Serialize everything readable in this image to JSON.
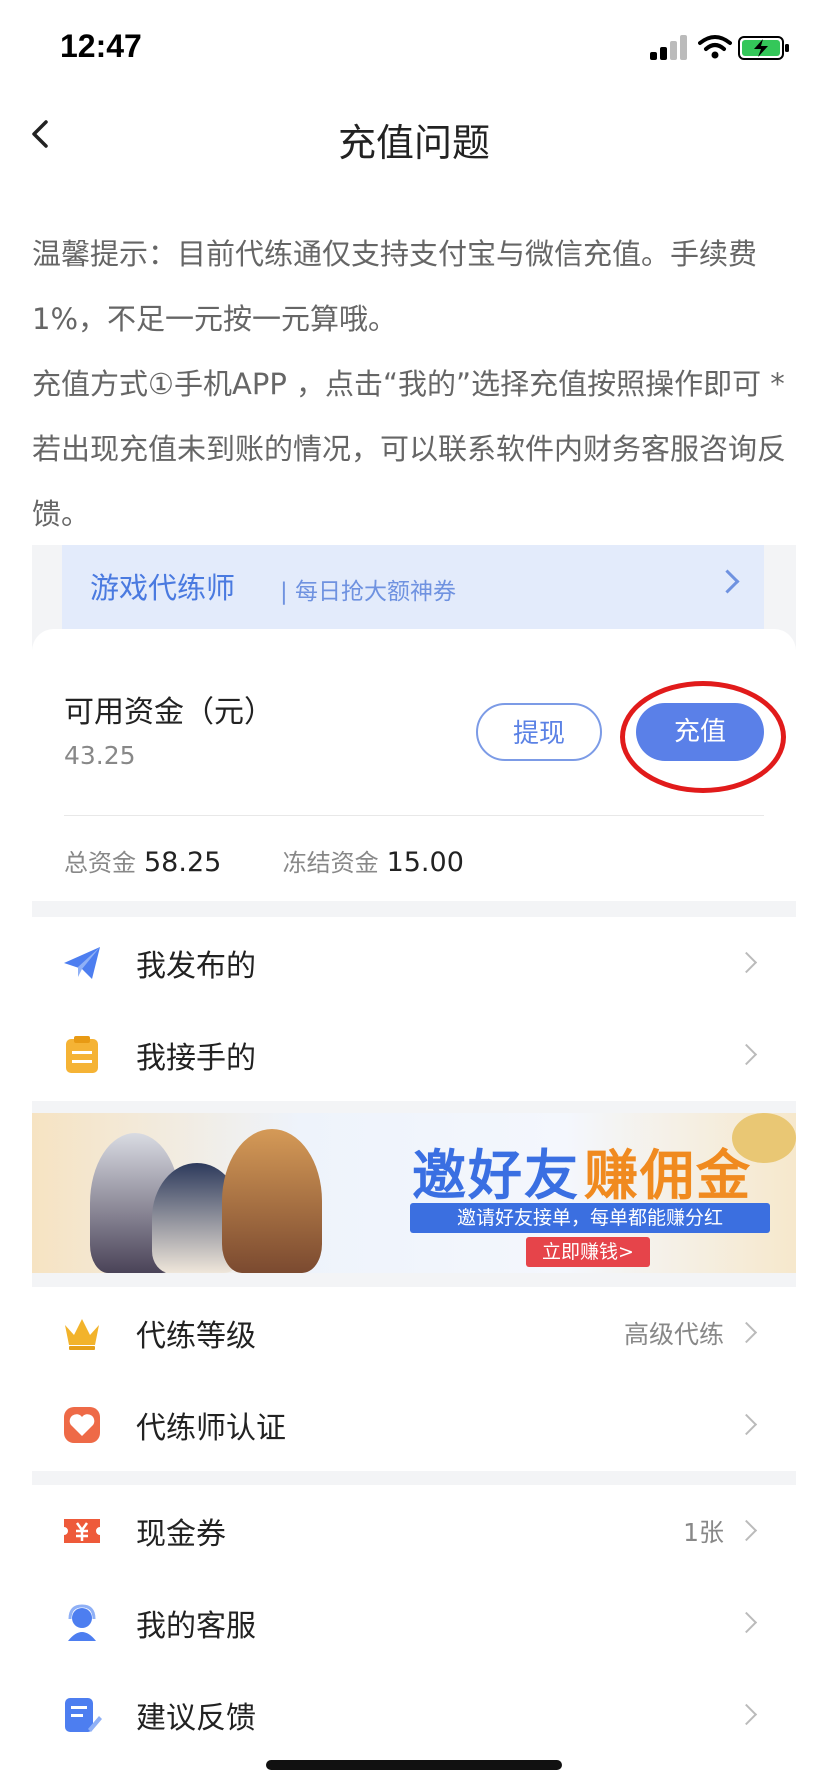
{
  "status_bar": {
    "time": "12:47"
  },
  "nav": {
    "title": "充值问题"
  },
  "intro": {
    "p1": "温馨提示：目前代练通仅支持支付宝与微信充值。手续费1%，不足一元按一元算哦。",
    "p2": "充值方式①手机APP ，点击“我的”选择充值按照操作即可 *若出现充值未到账的情况，可以联系软件内财务客服咨询反馈。"
  },
  "screenshot": {
    "banner": {
      "title": "游戏代练师",
      "subtitle": "| 每日抢大额神券"
    },
    "funds": {
      "label": "可用资金（元）",
      "value": "43.25",
      "withdraw_label": "提现",
      "recharge_label": "充值",
      "total_label": "总资金",
      "total_value": "58.25",
      "frozen_label": "冻结资金",
      "frozen_value": "15.00"
    },
    "menu1": [
      {
        "label": "我发布的",
        "icon": "paper-plane-icon"
      },
      {
        "label": "我接手的",
        "icon": "clipboard-icon"
      }
    ],
    "promo": {
      "title_part1": "邀好友",
      "title_part2": "赚佣金",
      "subtitle": "邀请好友接单，每单都能赚分红",
      "cta": "立即赚钱>"
    },
    "menu2": [
      {
        "label": "代练等级",
        "value": "高级代练",
        "icon": "crown-icon"
      },
      {
        "label": "代练师认证",
        "value": "",
        "icon": "heart-badge-icon"
      }
    ],
    "menu3": [
      {
        "label": "现金券",
        "value": "1张",
        "icon": "coupon-icon"
      },
      {
        "label": "我的客服",
        "value": "",
        "icon": "headset-icon"
      },
      {
        "label": "建议反馈",
        "value": "",
        "icon": "feedback-icon"
      }
    ],
    "colors": {
      "accent": "#5a80e8",
      "highlight_circle": "#e11b1b"
    }
  }
}
